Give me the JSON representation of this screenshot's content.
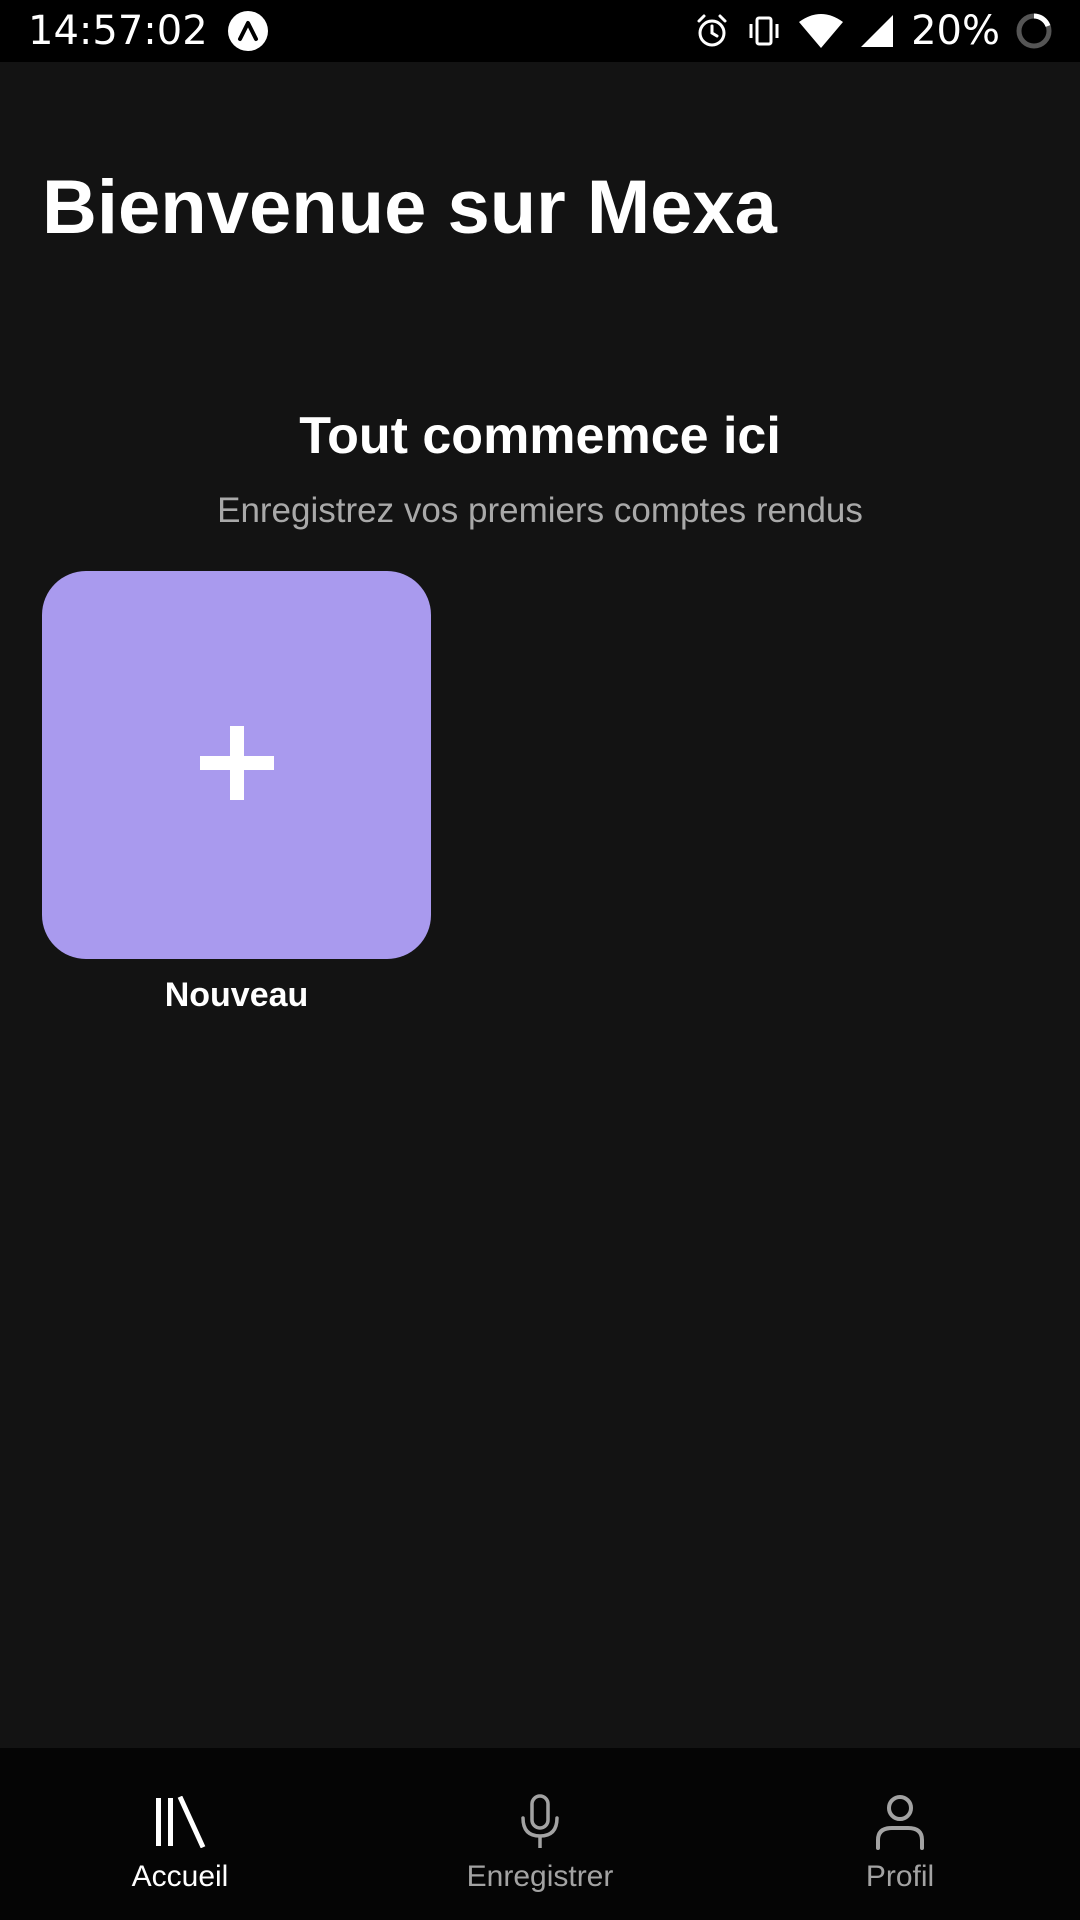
{
  "status_bar": {
    "time": "14:57:02",
    "battery": "20%",
    "icons": [
      "app-notification-icon",
      "alarm-icon",
      "vibrate-icon",
      "wifi-icon",
      "cell-signal-icon",
      "battery-ring-icon"
    ]
  },
  "header": {
    "title": "Bienvenue sur Mexa"
  },
  "empty_state": {
    "title": "Tout commemce ici",
    "subtitle": "Enregistrez vos premiers comptes rendus"
  },
  "new_card": {
    "label": "Nouveau",
    "icon": "plus-icon",
    "color": "#a99aee"
  },
  "bottom_nav": {
    "items": [
      {
        "label": "Accueil",
        "icon": "library-icon",
        "active": true
      },
      {
        "label": "Enregistrer",
        "icon": "microphone-icon",
        "active": false
      },
      {
        "label": "Profil",
        "icon": "user-icon",
        "active": false
      }
    ]
  },
  "colors": {
    "background": "#131313",
    "accent": "#a99aee",
    "nav_background": "#050505",
    "muted_text": "#a9a9a9"
  }
}
